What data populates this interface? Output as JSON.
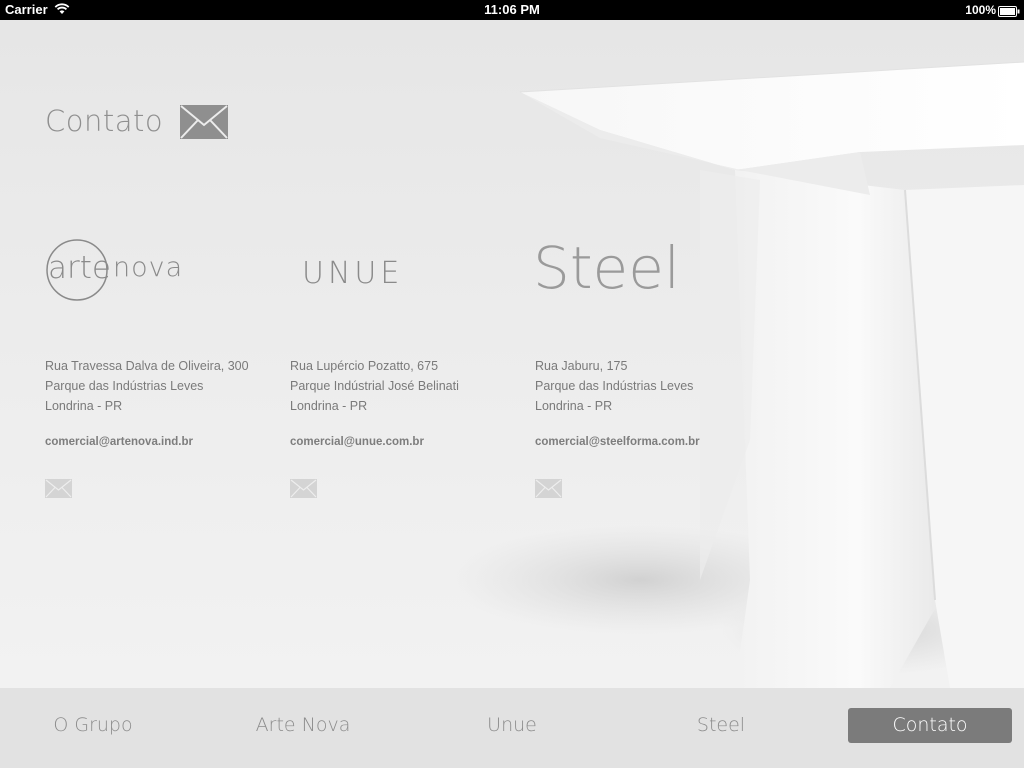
{
  "status_bar": {
    "carrier": "Carrier",
    "time": "11:06 PM",
    "battery": "100%"
  },
  "page": {
    "title": "Contato",
    "title_icon": "envelope-icon"
  },
  "brands": [
    {
      "logo_left": "arte",
      "logo_right": "nova",
      "address_line1": "Rua Travessa Dalva de Oliveira, 300",
      "address_line2": "Parque das Indústrias Leves",
      "address_line3": "Londrina - PR",
      "email": "comercial@artenova.ind.br",
      "icon": "envelope-icon"
    },
    {
      "logo": "UNUE",
      "address_line1": "Rua Lupércio Pozatto, 675",
      "address_line2": "Parque Indústrial José Belinati",
      "address_line3": "Londrina - PR",
      "email": "comercial@unue.com.br",
      "icon": "envelope-icon"
    },
    {
      "logo": "Steel",
      "address_line1": "Rua Jaburu, 175",
      "address_line2": "Parque das Indústrias Leves",
      "address_line3": "Londrina - PR",
      "email": "comercial@steelforma.com.br",
      "icon": "envelope-icon"
    }
  ],
  "tabs": [
    {
      "label": "O Grupo",
      "active": false
    },
    {
      "label": "Arte Nova",
      "active": false
    },
    {
      "label": "Unue",
      "active": false
    },
    {
      "label": "Steel",
      "active": false
    },
    {
      "label": "Contato",
      "active": true
    }
  ],
  "colors": {
    "active_tab_bg": "#7b7b7b",
    "text_gray": "#7a7a7a"
  }
}
